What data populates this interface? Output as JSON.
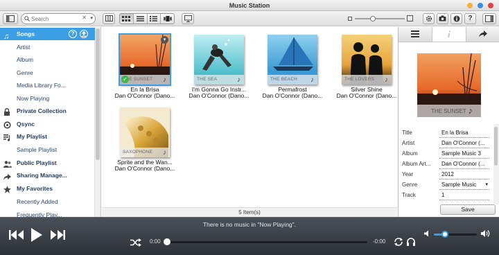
{
  "window": {
    "title": "Music Station"
  },
  "toolbar": {
    "search_placeholder": "Search"
  },
  "sidebar": {
    "items": [
      {
        "label": "Songs",
        "icon": "music-note-icon",
        "kind": "main",
        "active": true
      },
      {
        "label": "Artist",
        "kind": "sub"
      },
      {
        "label": "Album",
        "kind": "sub"
      },
      {
        "label": "Genre",
        "kind": "sub"
      },
      {
        "label": "Media Library Fo...",
        "kind": "sub"
      },
      {
        "label": "Now Playing",
        "kind": "sub"
      },
      {
        "label": "Private Collection",
        "icon": "lock-icon",
        "kind": "main"
      },
      {
        "label": "Qsync",
        "icon": "qsync-icon",
        "kind": "main"
      },
      {
        "label": "My Playlist",
        "icon": "playlist-icon",
        "kind": "main"
      },
      {
        "label": "Sample Playlist",
        "kind": "sub"
      },
      {
        "label": "Public Playlist",
        "icon": "people-icon",
        "kind": "main"
      },
      {
        "label": "Sharing Manage...",
        "icon": "share-icon",
        "kind": "main"
      },
      {
        "label": "My Favorites",
        "icon": "star-icon",
        "kind": "main"
      },
      {
        "label": "Recently Added",
        "kind": "sub"
      },
      {
        "label": "Frequently Play...",
        "kind": "sub"
      }
    ]
  },
  "content": {
    "songs": [
      {
        "title": "En la Brisa",
        "artist": "Dan O'Connor (Dano...",
        "cover_label": "THE SUNSET",
        "theme": "sunset",
        "selected": true
      },
      {
        "title": "I'm Gonna Go Instr...",
        "artist": "Dan O'Connor (Dano...",
        "cover_label": "THE SEA",
        "theme": "sea",
        "selected": false
      },
      {
        "title": "Permafrost",
        "artist": "Dan O'Connor (Dano...",
        "cover_label": "THE BEACH",
        "theme": "beach",
        "selected": false
      },
      {
        "title": "Silver Shine",
        "artist": "Dan O'Connor (Dano...",
        "cover_label": "THE LOVERS",
        "theme": "lovers",
        "selected": false
      },
      {
        "title": "Sprite and the Wan...",
        "artist": "Dan O'Connor (Dano...",
        "cover_label": "SAXOPHONE",
        "theme": "sax",
        "selected": false
      }
    ],
    "item_count": "5 Item(s)"
  },
  "details": {
    "cover_label": "THE SUNSET",
    "fields": [
      {
        "label": "Title",
        "value": "En la Brisa"
      },
      {
        "label": "Artist",
        "value": "Dan O'Connor (..."
      },
      {
        "label": "Album",
        "value": "Sample Music 3"
      },
      {
        "label": "Album Art...",
        "value": "Dan O'Connor (..."
      },
      {
        "label": "Year",
        "value": "2012"
      },
      {
        "label": "Genre",
        "value": "Sample Music"
      },
      {
        "label": "Track",
        "value": "1"
      }
    ],
    "save_label": "Save"
  },
  "player": {
    "message": "There is no music in \"Now Playing\".",
    "elapsed": "0:00",
    "remaining": "-0:00",
    "progress": 0,
    "volume": 0.25
  },
  "colors": {
    "accent": "#3c9fe6",
    "player_bg": "#2d3238"
  }
}
